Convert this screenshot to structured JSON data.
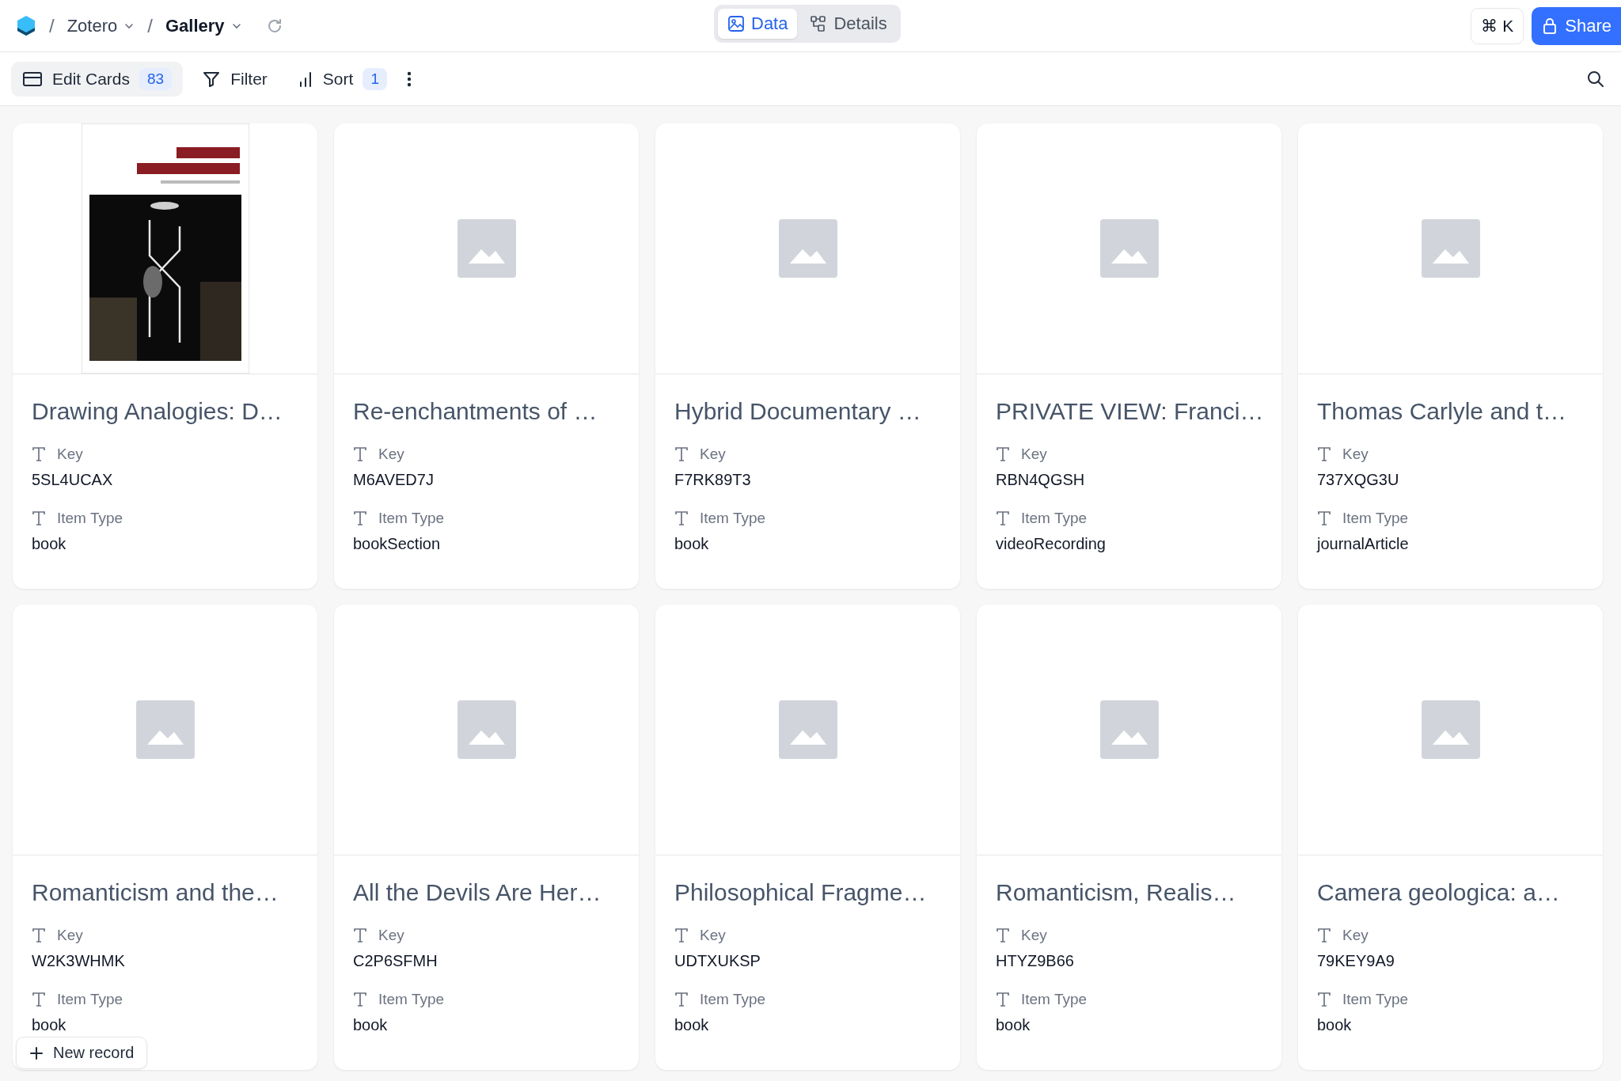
{
  "breadcrumb": {
    "separators": [
      "/",
      "/"
    ],
    "workspace": "Zotero",
    "view": "Gallery"
  },
  "view_switch": [
    {
      "label": "Data",
      "selected": true
    },
    {
      "label": "Details",
      "selected": false
    }
  ],
  "shortcut": "⌘ K",
  "share_button": "Share",
  "toolbar": {
    "edit_cards": {
      "label": "Edit Cards",
      "count": "83"
    },
    "filter": "Filter",
    "sort": {
      "label": "Sort",
      "count": "1"
    }
  },
  "cards": [
    {
      "title": "Drawing Analogies: D…",
      "kind": "picture",
      "fields": [
        {
          "label": "Key",
          "value": "5SL4UCAX"
        },
        {
          "label": "Item Type",
          "value": "book"
        }
      ]
    },
    {
      "title": "Re-enchantments of …",
      "kind": "placeholder",
      "fields": [
        {
          "label": "Key",
          "value": "M6AVED7J"
        },
        {
          "label": "Item Type",
          "value": "bookSection"
        }
      ]
    },
    {
      "title": "Hybrid Documentary …",
      "kind": "placeholder",
      "fields": [
        {
          "label": "Key",
          "value": "F7RK89T3"
        },
        {
          "label": "Item Type",
          "value": "book"
        }
      ]
    },
    {
      "title": "PRIVATE VIEW: Franci…",
      "kind": "placeholder",
      "fields": [
        {
          "label": "Key",
          "value": "RBN4QGSH"
        },
        {
          "label": "Item Type",
          "value": "videoRecording"
        }
      ]
    },
    {
      "title": "Thomas Carlyle and t…",
      "kind": "placeholder",
      "fields": [
        {
          "label": "Key",
          "value": "737XQG3U"
        },
        {
          "label": "Item Type",
          "value": "journalArticle"
        }
      ]
    },
    {
      "title": "Romanticism and the…",
      "kind": "placeholder",
      "fields": [
        {
          "label": "Key",
          "value": "W2K3WHMK"
        },
        {
          "label": "Item Type",
          "value": "book"
        }
      ]
    },
    {
      "title": "All the Devils Are Her…",
      "kind": "placeholder",
      "fields": [
        {
          "label": "Key",
          "value": "C2P6SFMH"
        },
        {
          "label": "Item Type",
          "value": "book"
        }
      ]
    },
    {
      "title": "Philosophical Fragme…",
      "kind": "placeholder",
      "fields": [
        {
          "label": "Key",
          "value": "UDTXUKSP"
        },
        {
          "label": "Item Type",
          "value": "book"
        }
      ]
    },
    {
      "title": "Romanticism, Realis…",
      "kind": "placeholder",
      "fields": [
        {
          "label": "Key",
          "value": "HTYZ9B66"
        },
        {
          "label": "Item Type",
          "value": "book"
        }
      ]
    },
    {
      "title": "Camera geologica: a…",
      "kind": "placeholder",
      "fields": [
        {
          "label": "Key",
          "value": "79KEY9A9"
        },
        {
          "label": "Item Type",
          "value": "book"
        }
      ]
    }
  ],
  "new_record_button": "New record"
}
